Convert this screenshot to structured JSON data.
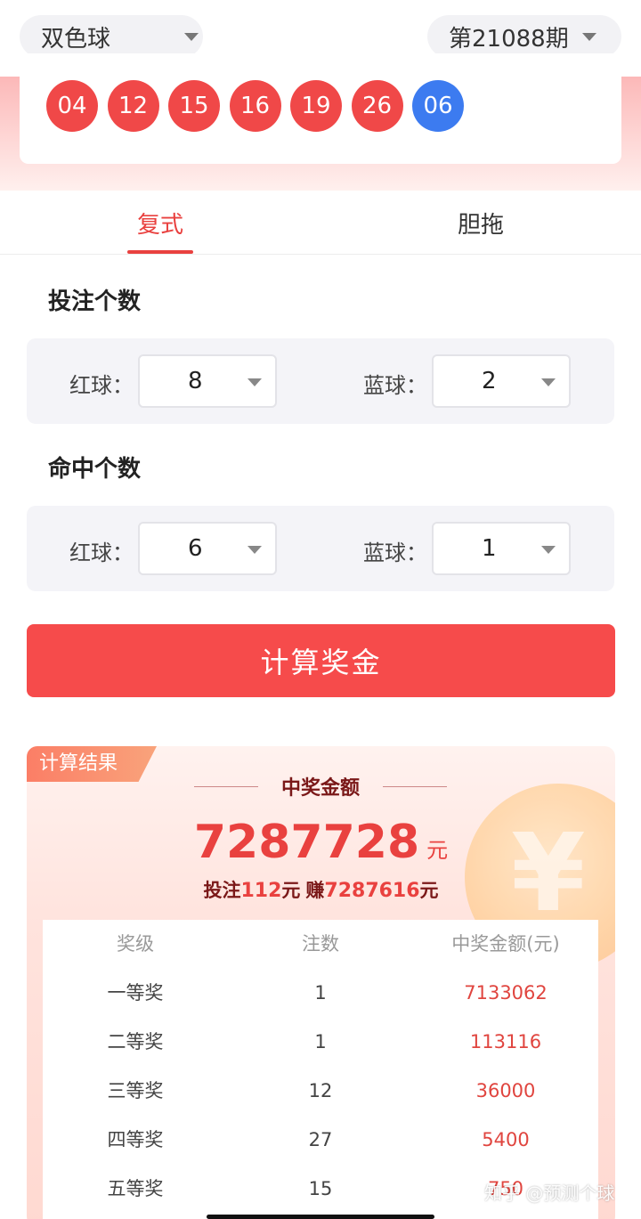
{
  "header": {
    "lottery_label": "双色球",
    "period_label": "第21088期"
  },
  "draw": {
    "red_balls": [
      "04",
      "12",
      "15",
      "16",
      "19",
      "26"
    ],
    "blue_ball": "06"
  },
  "tabs": {
    "fushi": "复式",
    "dantuo": "胆拖"
  },
  "bet_count": {
    "title": "投注个数",
    "red_label": "红球：",
    "red_value": "8",
    "blue_label": "蓝球：",
    "blue_value": "2"
  },
  "hit_count": {
    "title": "命中个数",
    "red_label": "红球：",
    "red_value": "6",
    "blue_label": "蓝球：",
    "blue_value": "1"
  },
  "calc_button": "计算奖金",
  "result": {
    "tag": "计算结果",
    "title": "中奖金额",
    "amount": "7287728",
    "amount_unit": "元",
    "bet_prefix": "投注",
    "bet_amount": "112",
    "bet_unit": "元",
    "earn_prefix": "赚",
    "earn_amount": "7287616",
    "earn_unit": "元",
    "coin_symbol": "¥",
    "table": {
      "headers": [
        "奖级",
        "注数",
        "中奖金额(元)"
      ],
      "rows": [
        [
          "一等奖",
          "1",
          "7133062"
        ],
        [
          "二等奖",
          "1",
          "113116"
        ],
        [
          "三等奖",
          "12",
          "36000"
        ],
        [
          "四等奖",
          "27",
          "5400"
        ],
        [
          "五等奖",
          "15",
          "750"
        ]
      ]
    }
  },
  "watermark": "知乎 @预测个球",
  "colors": {
    "accent_red": "#f64b4b",
    "blue_ball": "#3c7bf0"
  }
}
